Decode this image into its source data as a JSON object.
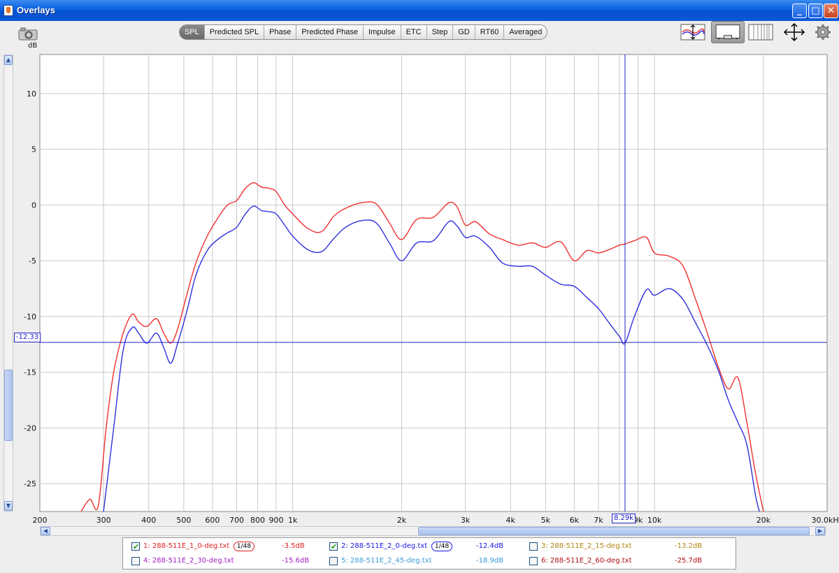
{
  "window": {
    "title": "Overlays"
  },
  "toolbar": {
    "tabs": [
      {
        "label": "SPL",
        "active": true
      },
      {
        "label": "Predicted SPL",
        "active": false
      },
      {
        "label": "Phase",
        "active": false
      },
      {
        "label": "Predicted Phase",
        "active": false
      },
      {
        "label": "Impulse",
        "active": false
      },
      {
        "label": "ETC",
        "active": false
      },
      {
        "label": "Step",
        "active": false
      },
      {
        "label": "GD",
        "active": false
      },
      {
        "label": "RT60",
        "active": false
      },
      {
        "label": "Averaged",
        "active": false
      }
    ]
  },
  "chart_data": {
    "type": "line",
    "ylabel": "dB",
    "xscale": "log",
    "xlim": [
      200,
      30000
    ],
    "ylim": [
      -27.5,
      13.5
    ],
    "yticks": [
      10,
      5,
      0,
      -5,
      -10,
      -15,
      -20,
      -25
    ],
    "ytick_labels": [
      "10",
      "5",
      "0",
      "-5",
      "-10",
      "-15",
      "-20",
      "-25"
    ],
    "xticks": [
      {
        "value": 200,
        "label": "200"
      },
      {
        "value": 300,
        "label": "300"
      },
      {
        "value": 400,
        "label": "400"
      },
      {
        "value": 500,
        "label": "500"
      },
      {
        "value": 600,
        "label": "600"
      },
      {
        "value": 700,
        "label": "700"
      },
      {
        "value": 800,
        "label": "800"
      },
      {
        "value": 900,
        "label": "900"
      },
      {
        "value": 1000,
        "label": "1k"
      },
      {
        "value": 2000,
        "label": "2k"
      },
      {
        "value": 3000,
        "label": "3k"
      },
      {
        "value": 4000,
        "label": "4k"
      },
      {
        "value": 5000,
        "label": "5k"
      },
      {
        "value": 6000,
        "label": "6k"
      },
      {
        "value": 7000,
        "label": "7k"
      },
      {
        "value": 9000,
        "label": "9k"
      },
      {
        "value": 10000,
        "label": "10k"
      },
      {
        "value": 20000,
        "label": "20k"
      },
      {
        "value": 30000,
        "label": "30.0kHz"
      }
    ],
    "minor_xgrid": [
      8000
    ],
    "grid": true,
    "cursor": {
      "x": 8290,
      "y": -12.33,
      "x_label": "8.29k",
      "y_label": "-12.33"
    },
    "series": [
      {
        "name": "1: 288-511E_1_0-deg.txt",
        "color": "#f03030",
        "x": [
          260,
          275,
          290,
          305,
          320,
          340,
          360,
          375,
          395,
          420,
          440,
          460,
          480,
          510,
          540,
          580,
          620,
          660,
          700,
          740,
          780,
          820,
          860,
          900,
          950,
          1000,
          1100,
          1200,
          1300,
          1400,
          1550,
          1700,
          1850,
          2000,
          2200,
          2450,
          2700,
          2850,
          3000,
          3200,
          3500,
          3800,
          4200,
          4600,
          5000,
          5500,
          6000,
          6500,
          7000,
          7500,
          8000,
          8290,
          8800,
          9500,
          10000,
          11000,
          12000,
          13000,
          14000,
          15000,
          16000,
          17000,
          18000,
          19000,
          20000
        ],
        "y": [
          -27.5,
          -26.4,
          -27.0,
          -20.0,
          -15.0,
          -11.5,
          -9.8,
          -10.5,
          -10.9,
          -10.2,
          -11.5,
          -12.4,
          -11.2,
          -8.0,
          -5.2,
          -2.8,
          -1.2,
          0.0,
          0.4,
          1.5,
          2.0,
          1.6,
          1.5,
          1.2,
          0.0,
          -0.8,
          -2.1,
          -2.4,
          -1.0,
          -0.3,
          0.2,
          0.1,
          -1.6,
          -3.1,
          -1.3,
          -1.1,
          0.2,
          -0.2,
          -1.8,
          -1.5,
          -2.6,
          -3.1,
          -3.6,
          -3.4,
          -3.8,
          -3.3,
          -5.0,
          -4.1,
          -4.3,
          -4.0,
          -3.6,
          -3.5,
          -3.2,
          -2.9,
          -4.3,
          -4.6,
          -5.5,
          -8.5,
          -11.5,
          -14.5,
          -16.5,
          -15.5,
          -19.5,
          -24.0,
          -27.5
        ]
      },
      {
        "name": "2: 288-511E_2_0-deg.txt",
        "color": "#3030e0",
        "x": [
          300,
          320,
          340,
          360,
          375,
          395,
          420,
          440,
          460,
          480,
          510,
          540,
          580,
          620,
          660,
          700,
          740,
          780,
          820,
          860,
          900,
          950,
          1000,
          1100,
          1200,
          1300,
          1400,
          1550,
          1700,
          1850,
          2000,
          2200,
          2450,
          2700,
          2850,
          3000,
          3200,
          3500,
          3800,
          4200,
          4600,
          5000,
          5500,
          6000,
          6500,
          7000,
          7500,
          8000,
          8290,
          8800,
          9500,
          10000,
          11000,
          12000,
          13000,
          14000,
          15000,
          16000,
          17000,
          18000,
          19000,
          19500
        ],
        "y": [
          -27.5,
          -20.0,
          -13.0,
          -11.0,
          -11.5,
          -12.4,
          -11.5,
          -12.8,
          -14.2,
          -12.5,
          -9.5,
          -6.3,
          -4.1,
          -3.1,
          -2.5,
          -2.0,
          -0.8,
          -0.1,
          -0.5,
          -0.6,
          -0.8,
          -1.8,
          -2.8,
          -4.0,
          -4.2,
          -3.0,
          -2.0,
          -1.4,
          -1.6,
          -3.4,
          -5.0,
          -3.4,
          -3.2,
          -1.5,
          -1.9,
          -2.9,
          -2.8,
          -3.8,
          -5.2,
          -5.5,
          -5.5,
          -6.3,
          -7.1,
          -7.3,
          -8.3,
          -9.3,
          -10.6,
          -11.8,
          -12.4,
          -10.0,
          -7.6,
          -8.1,
          -7.5,
          -8.5,
          -10.6,
          -12.6,
          -14.8,
          -17.5,
          -19.5,
          -21.5,
          -26.0,
          -27.5
        ]
      }
    ]
  },
  "legend": {
    "items": [
      {
        "name": "1: 288-511E_1_0-deg.txt",
        "value": "-3.5dB",
        "checked": true,
        "color": "#e02020",
        "smoothing": "1/48"
      },
      {
        "name": "2: 288-511E_2_0-deg.txt",
        "value": "-12.4dB",
        "checked": true,
        "color": "#1818e0",
        "smoothing": "1/48"
      },
      {
        "name": "3: 288-511E_2_15-deg.txt",
        "value": "-13.2dB",
        "checked": false,
        "color": "#b08410",
        "smoothing": ""
      },
      {
        "name": "4: 288-511E_2_30-deg.txt",
        "value": "-15.6dB",
        "checked": false,
        "color": "#a020c0",
        "smoothing": ""
      },
      {
        "name": "5: 288-511E_2_45-deg.txt",
        "value": "-18.9dB",
        "checked": false,
        "color": "#3a9ad6",
        "smoothing": ""
      },
      {
        "name": "6: 288-511E_2_60-deg.txt",
        "value": "-25.7dB",
        "checked": false,
        "color": "#b01010",
        "smoothing": ""
      }
    ]
  },
  "icons": {
    "camera": "camera-icon",
    "zoom_vertical": "vertical-zoom-icon",
    "display_mode": "display-mode-icon",
    "grid_lines": "grid-lines-icon",
    "pan": "pan-icon",
    "settings": "gear-icon"
  }
}
